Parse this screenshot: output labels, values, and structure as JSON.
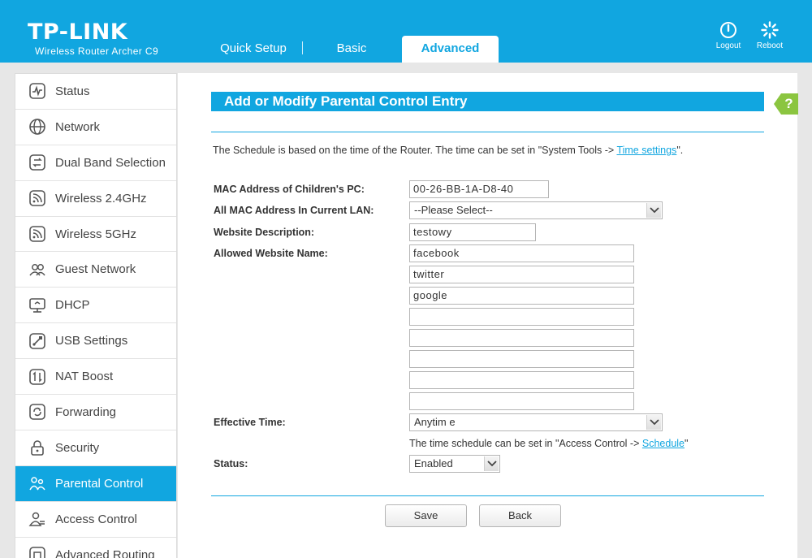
{
  "header": {
    "brand": "TP-LINK",
    "model": "Wireless Router Archer C9",
    "tabs": [
      {
        "label": "Quick Setup"
      },
      {
        "label": "Basic"
      },
      {
        "label": "Advanced",
        "active": true
      }
    ],
    "logout_label": "Logout",
    "reboot_label": "Reboot",
    "accent_color": "#11a6e0"
  },
  "sidebar": {
    "items": [
      {
        "label": "Status",
        "icon": "status-icon"
      },
      {
        "label": "Network",
        "icon": "globe-icon"
      },
      {
        "label": "Dual Band Selection",
        "icon": "dual-band-icon"
      },
      {
        "label": "Wireless 2.4GHz",
        "icon": "wireless-icon"
      },
      {
        "label": "Wireless 5GHz",
        "icon": "wireless-icon"
      },
      {
        "label": "Guest Network",
        "icon": "guest-icon"
      },
      {
        "label": "DHCP",
        "icon": "dhcp-icon"
      },
      {
        "label": "USB Settings",
        "icon": "usb-icon"
      },
      {
        "label": "NAT Boost",
        "icon": "nat-icon"
      },
      {
        "label": "Forwarding",
        "icon": "forwarding-icon"
      },
      {
        "label": "Security",
        "icon": "lock-icon"
      },
      {
        "label": "Parental Control",
        "icon": "parental-icon",
        "active": true
      },
      {
        "label": "Access Control",
        "icon": "access-icon"
      },
      {
        "label": "Advanced Routing",
        "icon": "routing-icon"
      }
    ]
  },
  "form": {
    "title": "Add or Modify Parental Control Entry",
    "help_label": "?",
    "note_prefix": "The Schedule is based on the time of the Router. The time can be set in \"System Tools -> ",
    "note_link": "Time settings",
    "note_suffix": "\".",
    "mac_label": "MAC Address of Children's PC:",
    "mac_value": "00-26-BB-1A-D8-40",
    "all_mac_label": "All MAC Address In Current LAN:",
    "all_mac_value": "--Please Select--",
    "desc_label": "Website Description:",
    "desc_value": "testowy",
    "allowed_label": "Allowed Website Name:",
    "allowed_sites": [
      "facebook",
      "twitter",
      "google",
      "",
      "",
      "",
      "",
      ""
    ],
    "effective_label": "Effective Time:",
    "effective_value": "Anytim e",
    "hint_prefix": "The time schedule can be set in \"Access Control -> ",
    "hint_link": "Schedule",
    "hint_suffix": "\"",
    "status_label": "Status:",
    "status_value": "Enabled",
    "save_label": "Save",
    "back_label": "Back"
  }
}
